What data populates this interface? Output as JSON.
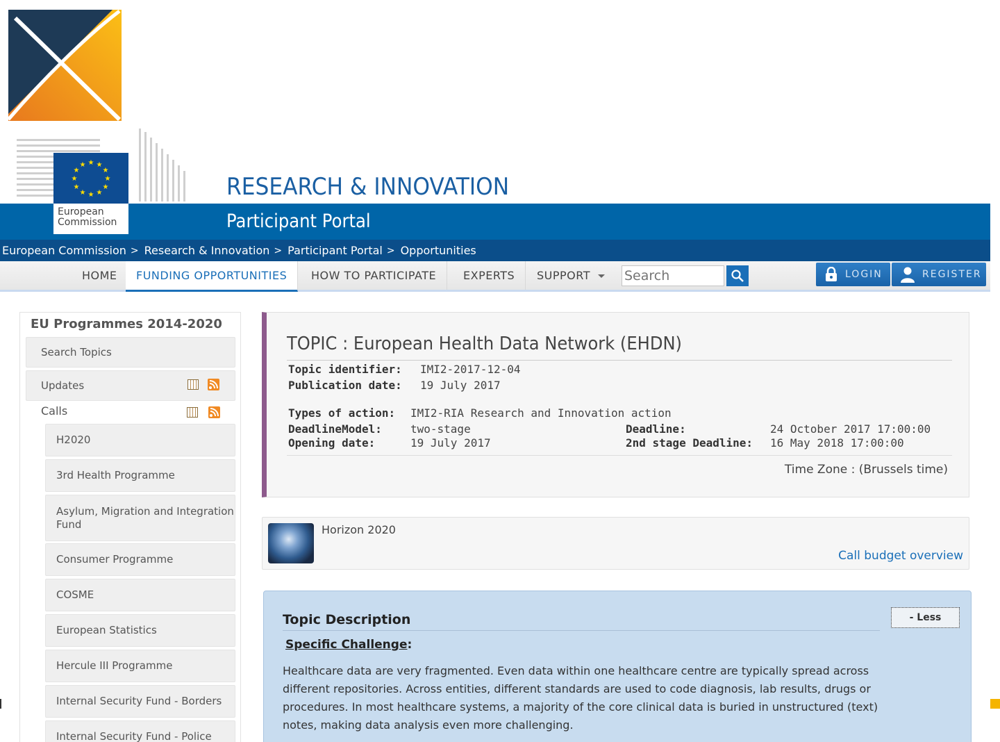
{
  "header": {
    "org_caption_line1": "European",
    "org_caption_line2": "Commission",
    "site_title": "RESEARCH & INNOVATION",
    "portal_title": "Participant Portal"
  },
  "breadcrumb": [
    {
      "label": "European Commission"
    },
    {
      "label": "Research & Innovation"
    },
    {
      "label": "Participant Portal"
    },
    {
      "label": "Opportunities"
    }
  ],
  "breadcrumb_separator": ">",
  "nav": {
    "items": [
      {
        "label": "HOME"
      },
      {
        "label": "FUNDING OPPORTUNITIES"
      },
      {
        "label": "HOW TO PARTICIPATE"
      },
      {
        "label": "EXPERTS"
      },
      {
        "label": "SUPPORT"
      }
    ],
    "search_placeholder": "Search",
    "login_label": "LOGIN",
    "register_label": "REGISTER"
  },
  "sidebar": {
    "title": "EU Programmes 2014-2020",
    "search_topics": "Search Topics",
    "updates": "Updates",
    "calls": "Calls",
    "programmes": [
      {
        "label": "H2020"
      },
      {
        "label": "3rd Health Programme"
      },
      {
        "label": "Asylum, Migration and Integration Fund"
      },
      {
        "label": "Consumer Programme"
      },
      {
        "label": "COSME"
      },
      {
        "label": "European Statistics"
      },
      {
        "label": "Hercule III Programme"
      },
      {
        "label": "Internal Security Fund - Borders"
      },
      {
        "label": "Internal Security Fund - Police"
      }
    ]
  },
  "topic": {
    "title": "TOPIC : European Health Data Network (EHDN)",
    "identifier_label": "Topic identifier:",
    "identifier_value": "IMI2-2017-12-04",
    "publication_label": "Publication date:",
    "publication_value": "19 July 2017",
    "types_label": "Types of action:",
    "types_value": "IMI2-RIA Research and Innovation action",
    "deadline_model_label": "DeadlineModel:",
    "deadline_model_value": "two-stage",
    "opening_label": "Opening date:",
    "opening_value": "19 July 2017",
    "deadline_label": "Deadline:",
    "deadline_value": "24 October 2017 17:00:00",
    "second_deadline_label": "2nd stage Deadline:",
    "second_deadline_value": "16 May 2018 17:00:00",
    "timezone": "Time Zone : (Brussels time)"
  },
  "programme_box": {
    "name": "Horizon 2020",
    "budget_link": "Call budget overview"
  },
  "description": {
    "title": "Topic Description",
    "less_label": "- Less",
    "sub_heading": "Specific Challenge",
    "sub_heading_suffix": ":",
    "text": "Healthcare data are very fragmented. Even data within one healthcare centre are typically spread across different repositories. Across entities, different standards are used to code diagnosis, lab results, drugs or procedures. In most healthcare systems, a majority of the core clinical data is buried in unstructured (text) notes, making data analysis even more challenging."
  },
  "icons": {
    "logo": "x-logo-icon",
    "flag": "eu-flag-icon",
    "search": "search-icon",
    "lock": "lock-icon",
    "user": "user-icon",
    "calendar": "calendar-icon",
    "rss": "rss-icon",
    "dropdown": "caret-down-icon",
    "globe": "globe-icon"
  },
  "colors": {
    "portal_blue": "#0065a8",
    "breadcrumb_blue": "#0b4e8a",
    "accent_blue": "#1a6fb8",
    "topic_accent": "#8d5a8c",
    "desc_background": "#c8dcef",
    "logo_orange": "#f39a1e",
    "logo_navy": "#1e3a56"
  }
}
